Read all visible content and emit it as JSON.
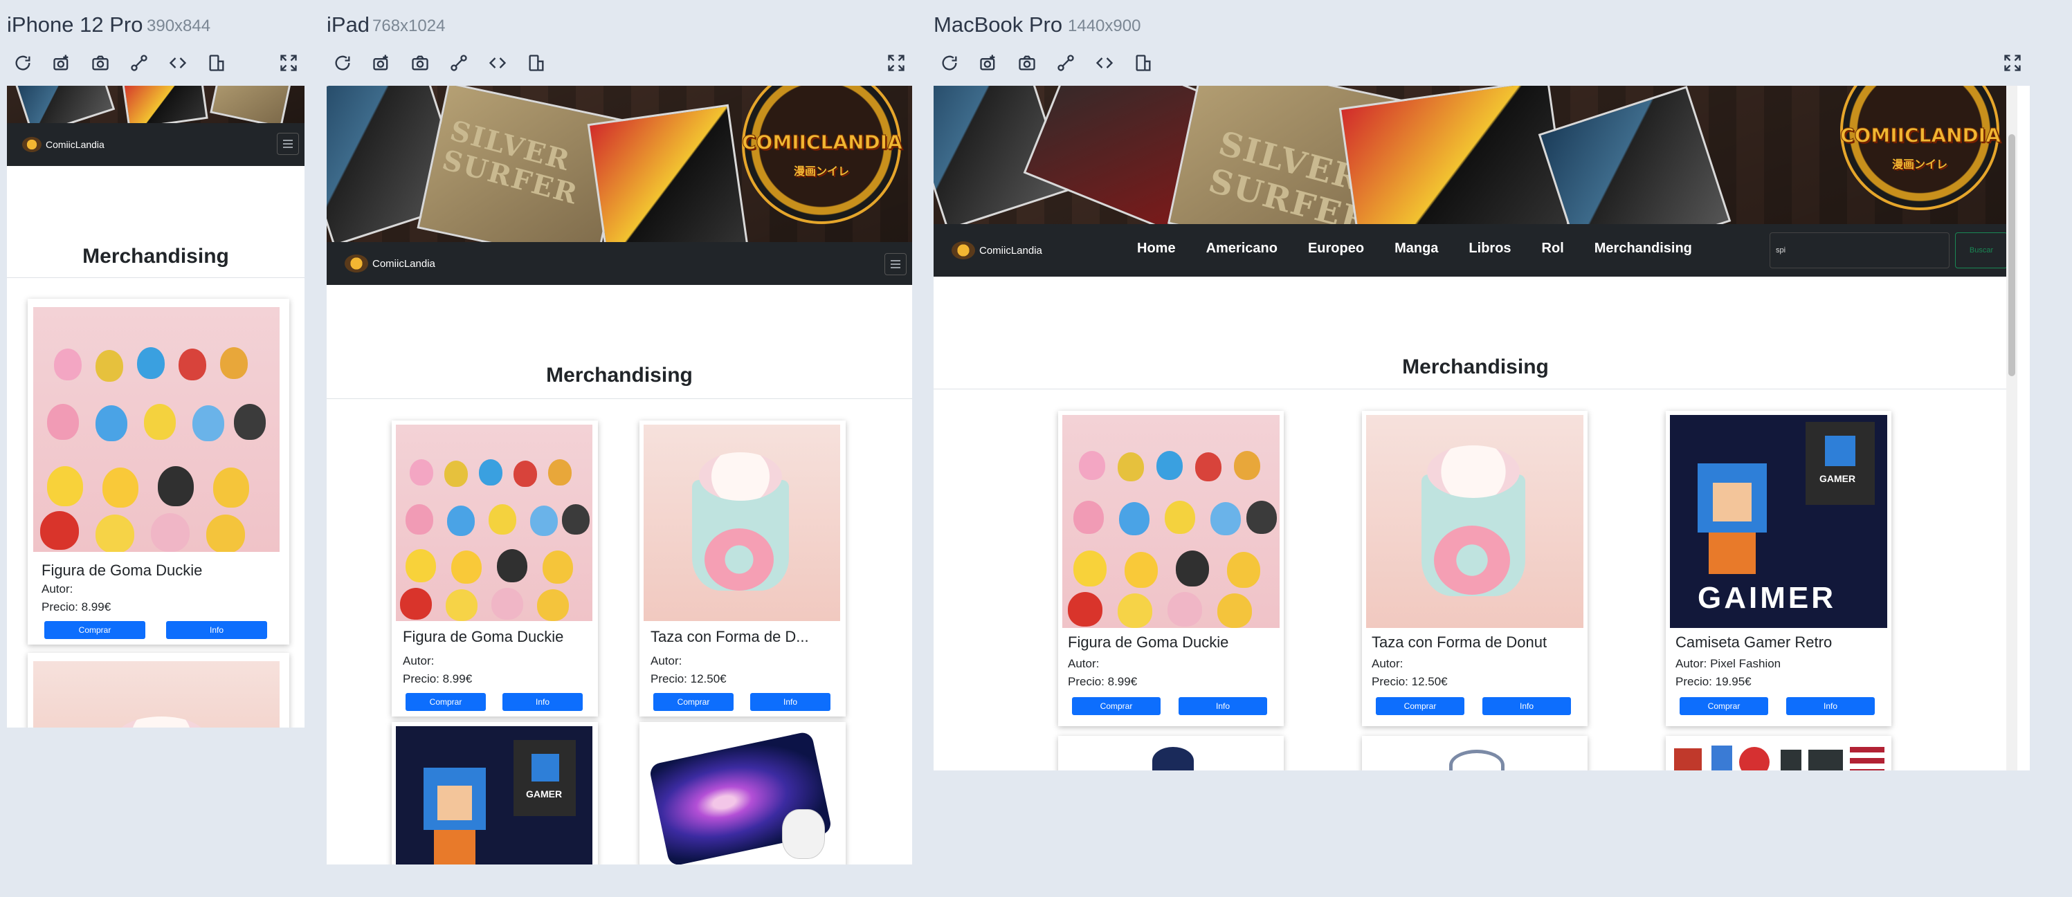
{
  "devices": [
    {
      "name": "iPhone 12 Pro",
      "size": "390x844"
    },
    {
      "name": "iPad",
      "size": "768x1024"
    },
    {
      "name": "MacBook Pro",
      "size": "1440x900"
    }
  ],
  "toolbar_icons": [
    "reload-icon",
    "screenshot-full-icon",
    "camera-icon",
    "link-icon",
    "code-icon",
    "rotate-icon",
    "fullscreen-icon"
  ],
  "site": {
    "brand": "ComiicLandia",
    "logo_text": "COMIICLANDIA",
    "logo_sub": "漫画ンイレ",
    "hero_text": "SILVER SURFER",
    "nav": [
      "Home",
      "Americano",
      "Europeo",
      "Manga",
      "Libros",
      "Rol",
      "Merchandising"
    ],
    "search_value": "spi",
    "search_button": "Buscar",
    "section_title": "Merchandising"
  },
  "products": [
    {
      "title": "Figura de Goma Duckie",
      "title_ipad": "Figura de Goma Duckie",
      "author": "Autor:",
      "price": "Precio: 8.99€"
    },
    {
      "title": "Taza con Forma de Donut",
      "title_ipad": "Taza con Forma de D...",
      "author": "Autor:",
      "price": "Precio: 12.50€"
    },
    {
      "title": "Camiseta Gamer Retro",
      "author": "Autor: Pixel Fashion",
      "price": "Precio: 19.95€",
      "shirt_text": "GAMER",
      "big_text": "GAIMER"
    }
  ],
  "buttons": {
    "buy": "Comprar",
    "info": "Info"
  },
  "colors": {
    "page_bg": "#e2e8f0",
    "navbar": "#212529",
    "primary": "#0d6efd",
    "search_btn": "#198754"
  }
}
